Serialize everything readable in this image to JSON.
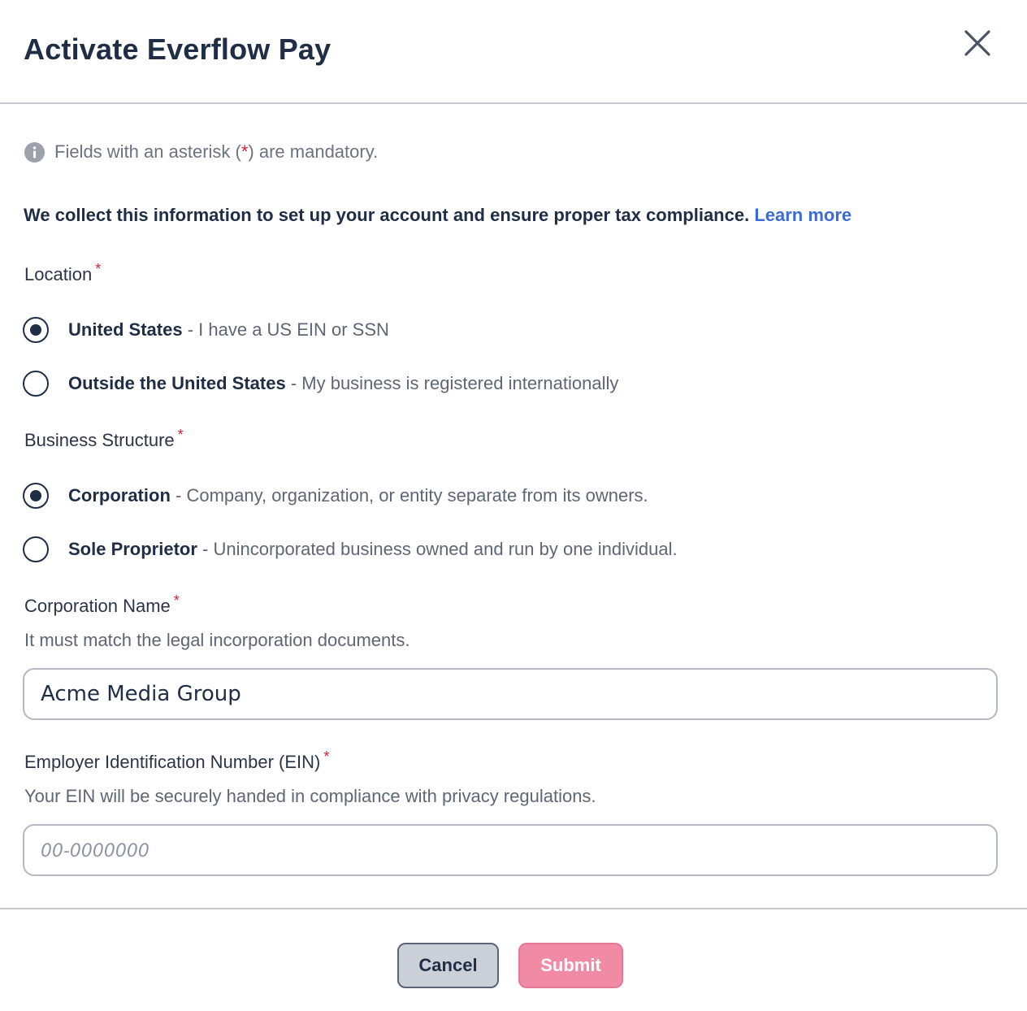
{
  "dialog": {
    "title": "Activate Everflow Pay"
  },
  "note": {
    "prefix": "Fields with an asterisk (",
    "asterisk": "*",
    "suffix": ") are mandatory."
  },
  "intro": {
    "text": "We collect this information to set up your account and ensure proper tax compliance.",
    "link": "Learn more"
  },
  "location": {
    "label": "Location",
    "required_mark": "*",
    "options": [
      {
        "title": "United States",
        "description": " - I have a US EIN or SSN",
        "selected": true
      },
      {
        "title": "Outside the United States",
        "description": " - My business is registered internationally",
        "selected": false
      }
    ]
  },
  "business_structure": {
    "label": "Business Structure",
    "required_mark": "*",
    "options": [
      {
        "title": "Corporation",
        "description": " - Company, organization, or entity separate from its owners.",
        "selected": true
      },
      {
        "title": "Sole Proprietor",
        "description": " - Unincorporated business owned and run by one individual.",
        "selected": false
      }
    ]
  },
  "corporation_name": {
    "label": "Corporation Name",
    "required_mark": "*",
    "hint": "It must match the legal incorporation documents.",
    "value": "Acme Media Group"
  },
  "ein": {
    "label": "Employer Identification Number (EIN)",
    "required_mark": "*",
    "hint": "Your EIN will be securely handed in compliance with privacy regulations.",
    "value": "",
    "placeholder": "00-0000000"
  },
  "footer": {
    "cancel_label": "Cancel",
    "submit_label": "Submit"
  },
  "colors": {
    "primary_text": "#1f2d45",
    "link": "#3d6bd6",
    "required": "#d21f3c",
    "submit_bg": "#f08aa5"
  },
  "icons": {
    "close": "close-icon",
    "info": "info-icon"
  }
}
